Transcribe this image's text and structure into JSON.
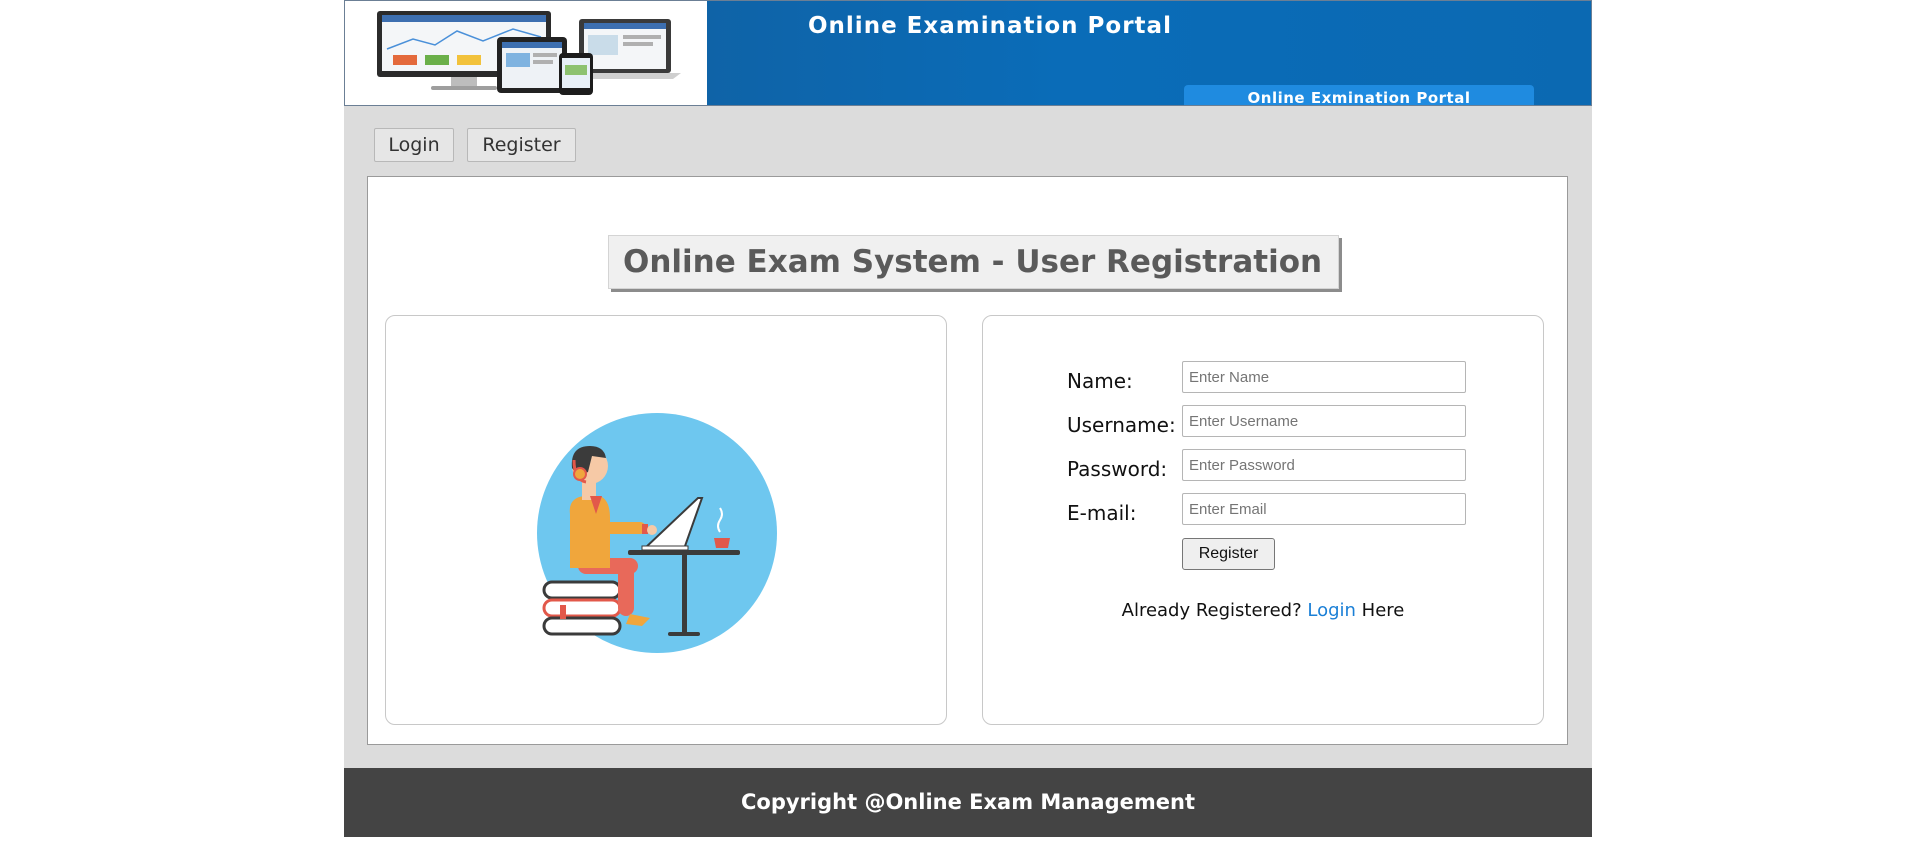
{
  "banner": {
    "title": "Online Examination Portal",
    "tab_label": "Online Exmination Portal"
  },
  "nav": {
    "login_label": "Login",
    "register_label": "Register"
  },
  "page_title": "Online Exam System - User Registration",
  "form": {
    "name_label": "Name:",
    "name_placeholder": "Enter Name",
    "username_label": "Username:",
    "username_placeholder": "Enter Username",
    "password_label": "Password:",
    "password_placeholder": "Enter Password",
    "email_label": "E-mail:",
    "email_placeholder": "Enter Email",
    "submit_label": "Register",
    "already_prefix": "Already Registered?",
    "login_link": "Login",
    "already_suffix": "Here"
  },
  "footer": {
    "copyright": "Copyright @Online Exam Management"
  },
  "colors": {
    "banner_blue": "#0b69b2",
    "link_blue": "#1a7fd6",
    "footer_bg": "#444444",
    "page_bg": "#dcdcdc"
  }
}
